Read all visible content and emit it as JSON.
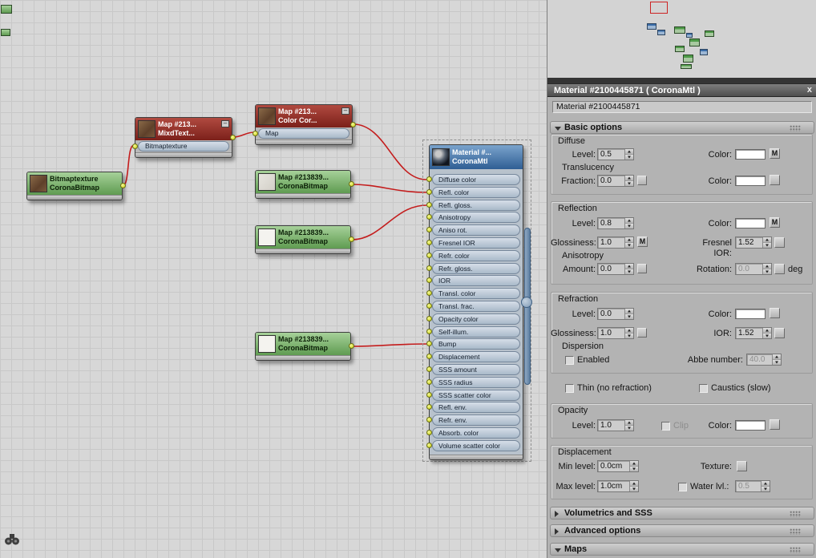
{
  "colors": {
    "wire": "#c41d1d",
    "node_green": "#6fae5f",
    "node_red": "#9c2a24",
    "node_blue": "#3c6ea6",
    "socket": "#dce23e",
    "selection": "#cc2222"
  },
  "canvas": {
    "nodes": {
      "bitmaptexture": {
        "title": "Bitmaptexture",
        "subtitle": "CoronaBitmap"
      },
      "mix": {
        "title": "Map #213...",
        "subtitle": "MixdText...",
        "slot": "Bitmaptexture",
        "minimize": "–"
      },
      "colorcorrect": {
        "title": "Map #213...",
        "subtitle": "Color Cor...",
        "slot": "Map",
        "minimize": "–"
      },
      "bitmap2": {
        "title": "Map #213839...",
        "subtitle": "CoronaBitmap"
      },
      "bitmap3": {
        "title": "Map #213839...",
        "subtitle": "CoronaBitmap"
      },
      "bitmap4": {
        "title": "Map #213839...",
        "subtitle": "CoronaBitmap"
      },
      "material": {
        "title": "Material #...",
        "subtitle": "CoronaMtl",
        "slots": [
          "Diffuse color",
          "Refl. color",
          "Refl. gloss.",
          "Anisotropy",
          "Aniso rot.",
          "Fresnel IOR",
          "Refr. color",
          "Refr. gloss.",
          "IOR",
          "Transl. color",
          "Transl. frac.",
          "Opacity color",
          "Self-illum.",
          "Bump",
          "Displacement",
          "SSS amount",
          "SSS radius",
          "SSS scatter color",
          "Refl. env.",
          "Refr. env.",
          "Absorb. color",
          "Volume scatter color"
        ]
      }
    }
  },
  "panel": {
    "title": "Material #2100445871 ( CoronaMtl )",
    "close": "x",
    "name_field": "Material #2100445871",
    "rollouts": {
      "basic": "Basic options",
      "volumetrics": "Volumetrics and SSS",
      "advanced": "Advanced options",
      "maps": "Maps"
    },
    "basic": {
      "diffuse": {
        "label": "Diffuse",
        "level_label": "Level:",
        "level": "0.5",
        "color_label": "Color:",
        "map_btn": "M",
        "translucency_label": "Translucency",
        "fraction_label": "Fraction:",
        "fraction": "0.0",
        "t_color_label": "Color:"
      },
      "reflection": {
        "label": "Reflection",
        "level_label": "Level:",
        "level": "0.8",
        "color_label": "Color:",
        "map_btn": "M",
        "gloss_label": "Glossiness:",
        "gloss": "1.0",
        "gloss_map": "M",
        "fresnel_label": "Fresnel IOR:",
        "fresnel": "1.52",
        "aniso_label": "Anisotropy",
        "amount_label": "Amount:",
        "amount": "0.0",
        "rotation_label": "Rotation:",
        "rotation": "0.0",
        "deg": "deg"
      },
      "refraction": {
        "label": "Refraction",
        "level_label": "Level:",
        "level": "0.0",
        "color_label": "Color:",
        "gloss_label": "Glossiness:",
        "gloss": "1.0",
        "ior_label": "IOR:",
        "ior": "1.52",
        "dispersion_label": "Dispersion",
        "enabled_label": "Enabled",
        "abbe_label": "Abbe number:",
        "abbe": "40.0",
        "thin_label": "Thin (no refraction)",
        "caustics_label": "Caustics (slow)"
      },
      "opacity": {
        "label": "Opacity",
        "level_label": "Level:",
        "level": "1.0",
        "clip_label": "Clip",
        "color_label": "Color:"
      },
      "displacement": {
        "label": "Displacement",
        "min_label": "Min level:",
        "min": "0.0cm",
        "texture_label": "Texture:",
        "max_label": "Max level:",
        "max": "1.0cm",
        "water_label": "Water lvl.:",
        "water": "0.5"
      }
    }
  }
}
